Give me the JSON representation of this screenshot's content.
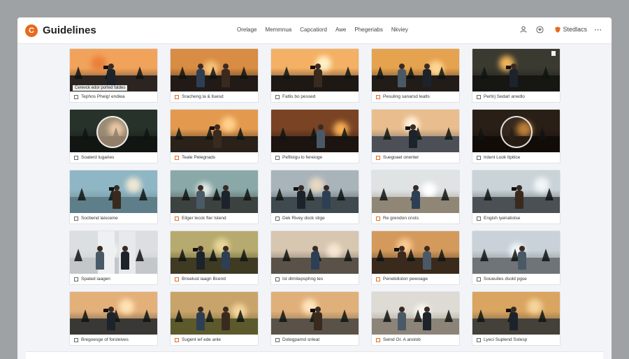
{
  "header": {
    "app_title": "Guidelines",
    "logo_letter": "C",
    "accent": "#e86a1f",
    "nav": [
      "Orelage",
      "Memmnua",
      "Capcatiord",
      "Awe",
      "Phegeriabs",
      "Nkviey"
    ],
    "studios_label": "Stedlacs"
  },
  "cards": [
    {
      "caption": "Tephos Pheig! endiea",
      "overlay": "Cerevck edor ported fatdes",
      "scene": "forest-sunset",
      "figures": 1
    },
    {
      "caption": "Sracheng la & lluesd",
      "scene": "dusk-hills",
      "figures": 2
    },
    {
      "caption": "Fatlis bo pessed",
      "scene": "sun-burst",
      "figures": 1
    },
    {
      "caption": "Pesuling sanarsd leatls",
      "scene": "golden-pair",
      "figures": 2
    },
    {
      "caption": "Pertirj Sedarl anedlo",
      "scene": "night-trees",
      "figures": 1,
      "tag": true
    },
    {
      "caption": "Soaterd lugaries",
      "scene": "portrait-ring",
      "figures": 0
    },
    {
      "caption": "Teale Pelegnads",
      "scene": "sunset-man",
      "figures": 1
    },
    {
      "caption": "Pefiloigu lo fereioge",
      "scene": "bokeh-woman",
      "figures": 1
    },
    {
      "caption": "Suegoael onenter",
      "scene": "beach-woman",
      "figures": 1
    },
    {
      "caption": "Irdenl Look ltpitice",
      "scene": "bokeh-ring",
      "figures": 0
    },
    {
      "caption": "Socbend laisceine",
      "scene": "lake-woman",
      "figures": 1
    },
    {
      "caption": "Eilger lecck fter lstend",
      "scene": "lake-pair",
      "figures": 2
    },
    {
      "caption": "Dek Rivey dock stige",
      "scene": "mountain-pair",
      "figures": 2
    },
    {
      "caption": "Re grendon cnsts",
      "scene": "field-photographer",
      "figures": 1
    },
    {
      "caption": "Engish iyeiratiolse",
      "scene": "snow-photographer",
      "figures": 1
    },
    {
      "caption": "Spated iaagen",
      "scene": "split-portrait",
      "figures": 2
    },
    {
      "caption": "Bnselust iaagn Bcend",
      "scene": "field-pair",
      "figures": 2
    },
    {
      "caption": "Ist dtmitepsphng tes",
      "scene": "river-crouch",
      "figures": 1
    },
    {
      "caption": "Penetidiolon pewoage",
      "scene": "camp-guitar",
      "figures": 2
    },
    {
      "caption": "Soueuiles dsold pgse",
      "scene": "road-photographer",
      "figures": 1
    },
    {
      "caption": "Bregoesge of forsleives",
      "scene": "dusk-photographer",
      "figures": 1
    },
    {
      "caption": "Sugent ief ede anle",
      "scene": "grass-women",
      "figures": 2
    },
    {
      "caption": "Dotegparnd snleat",
      "scene": "lake-sit",
      "figures": 1
    },
    {
      "caption": "Seind Or. A anolob",
      "scene": "beach-walkers",
      "figures": 2
    },
    {
      "caption": "Lyeci Suplend Sstesp",
      "scene": "autumn-crouch",
      "figures": 1
    }
  ]
}
